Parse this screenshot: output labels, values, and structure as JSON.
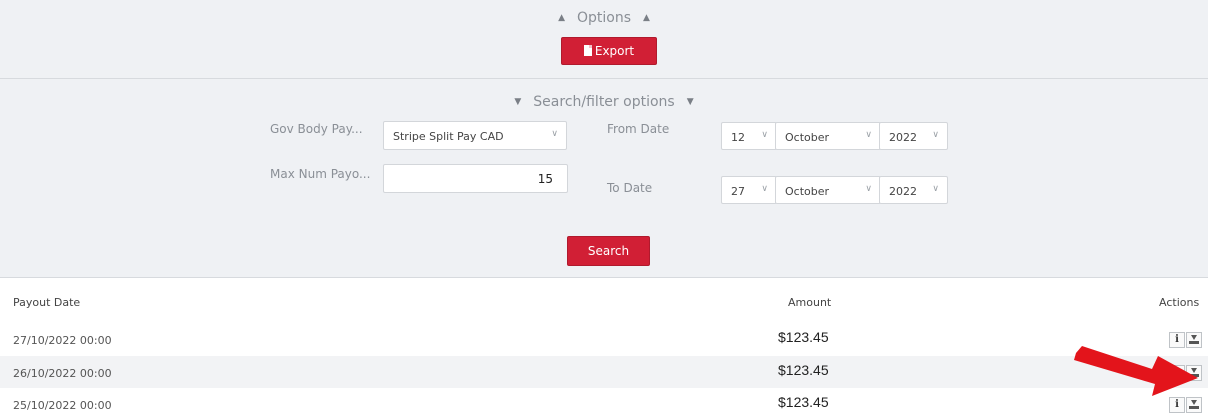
{
  "options": {
    "title": "Options",
    "export_label": "Export"
  },
  "filters": {
    "title": "Search/filter options",
    "gov_body_label": "Gov Body Pay...",
    "gov_body_value": "Stripe Split Pay CAD",
    "max_num_label": "Max Num Payo...",
    "max_num_value": "15",
    "from_date_label": "From Date",
    "from_day": "12",
    "from_month": "October",
    "from_year": "2022",
    "to_date_label": "To Date",
    "to_day": "27",
    "to_month": "October",
    "to_year": "2022",
    "search_label": "Search"
  },
  "table": {
    "headers": {
      "date": "Payout Date",
      "amount": "Amount",
      "actions": "Actions"
    },
    "rows": [
      {
        "date": "27/10/2022 00:00",
        "amount": "$123.45"
      },
      {
        "date": "26/10/2022 00:00",
        "amount": "$123.45"
      },
      {
        "date": "25/10/2022 00:00",
        "amount": "$123.45"
      }
    ]
  },
  "icons": {
    "triangle_up": "▲",
    "triangle_down": "▼",
    "chevron_down": "∨",
    "info": "i"
  },
  "colors": {
    "accent": "#d11f35",
    "panel_bg": "#eff1f4",
    "arrow": "#e3141b"
  }
}
